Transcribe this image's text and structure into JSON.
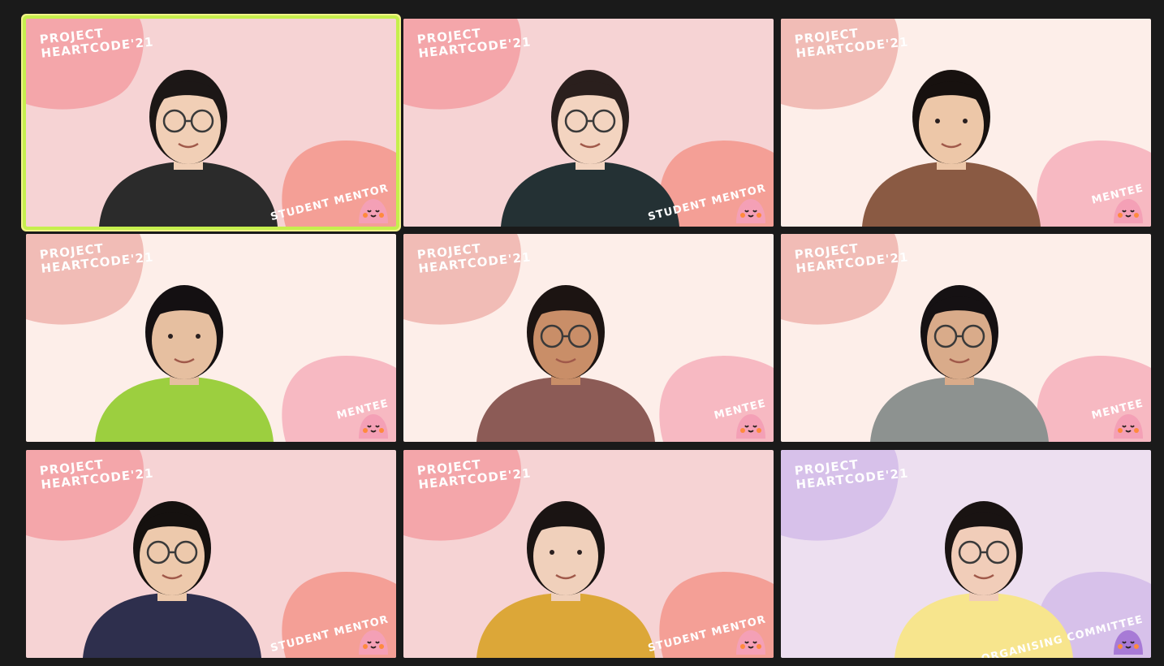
{
  "meeting": {
    "tiles": [
      {
        "brand_line1": "PROJECT",
        "brand_line2": "HEARTCODE'21",
        "role": "STUDENT MENTOR",
        "bg": "#f6d3d4",
        "blob1": "#f4a6aa",
        "blob2": "#f49f96",
        "shirt": "#2b2b2b",
        "skin": "#f1cfb6",
        "hair": "#1c1716",
        "glasses": true,
        "active_speaker": true
      },
      {
        "brand_line1": "PROJECT",
        "brand_line2": "HEARTCODE'21",
        "role": "STUDENT MENTOR",
        "bg": "#f6d3d4",
        "blob1": "#f4a6aa",
        "blob2": "#f49f96",
        "shirt": "#243134",
        "skin": "#f3d4c0",
        "hair": "#2a1f1d",
        "glasses": true,
        "active_speaker": false
      },
      {
        "brand_line1": "PROJECT",
        "brand_line2": "HEARTCODE'21",
        "role": "MENTEE",
        "bg": "#fdeee9",
        "blob1": "#f1bcb6",
        "blob2": "#f7b9c2",
        "shirt": "#8a5a43",
        "skin": "#edc7a8",
        "hair": "#17110f",
        "glasses": false,
        "active_speaker": false
      },
      {
        "brand_line1": "PROJECT",
        "brand_line2": "HEARTCODE'21",
        "role": "MENTEE",
        "bg": "#fdeee9",
        "blob1": "#f1bcb6",
        "blob2": "#f7b9c2",
        "shirt": "#9ccf3f",
        "skin": "#e6bfa0",
        "hair": "#141012",
        "glasses": false,
        "active_speaker": false
      },
      {
        "brand_line1": "PROJECT",
        "brand_line2": "HEARTCODE'21",
        "role": "MENTEE",
        "bg": "#fdeee9",
        "blob1": "#f1bcb6",
        "blob2": "#f7b9c2",
        "shirt": "#8c5b56",
        "skin": "#c98e68",
        "hair": "#1c1412",
        "glasses": true,
        "active_speaker": false
      },
      {
        "brand_line1": "PROJECT",
        "brand_line2": "HEARTCODE'21",
        "role": "MENTEE",
        "bg": "#fdeee9",
        "blob1": "#f1bcb6",
        "blob2": "#f7b9c2",
        "shirt": "#8d9290",
        "skin": "#d9ab8a",
        "hair": "#151113",
        "glasses": true,
        "active_speaker": false
      },
      {
        "brand_line1": "PROJECT",
        "brand_line2": "HEARTCODE'21",
        "role": "STUDENT MENTOR",
        "bg": "#f6d3d4",
        "blob1": "#f4a6aa",
        "blob2": "#f49f96",
        "shirt": "#2e2f4d",
        "skin": "#edc9ac",
        "hair": "#15110f",
        "glasses": true,
        "active_speaker": false
      },
      {
        "brand_line1": "PROJECT",
        "brand_line2": "HEARTCODE'21",
        "role": "STUDENT MENTOR",
        "bg": "#f6d3d4",
        "blob1": "#f4a6aa",
        "blob2": "#f49f96",
        "shirt": "#dca738",
        "skin": "#f0d0bb",
        "hair": "#1a1413",
        "glasses": false,
        "active_speaker": false
      },
      {
        "brand_line1": "PROJECT",
        "brand_line2": "HEARTCODE'21",
        "role": "ORGANISING COMMITTEE",
        "bg": "#eddff0",
        "blob1": "#d7c1ea",
        "blob2": "#d7c1ea",
        "shirt": "#f7e58d",
        "skin": "#f1cdb9",
        "hair": "#191312",
        "glasses": true,
        "active_speaker": false
      }
    ]
  }
}
